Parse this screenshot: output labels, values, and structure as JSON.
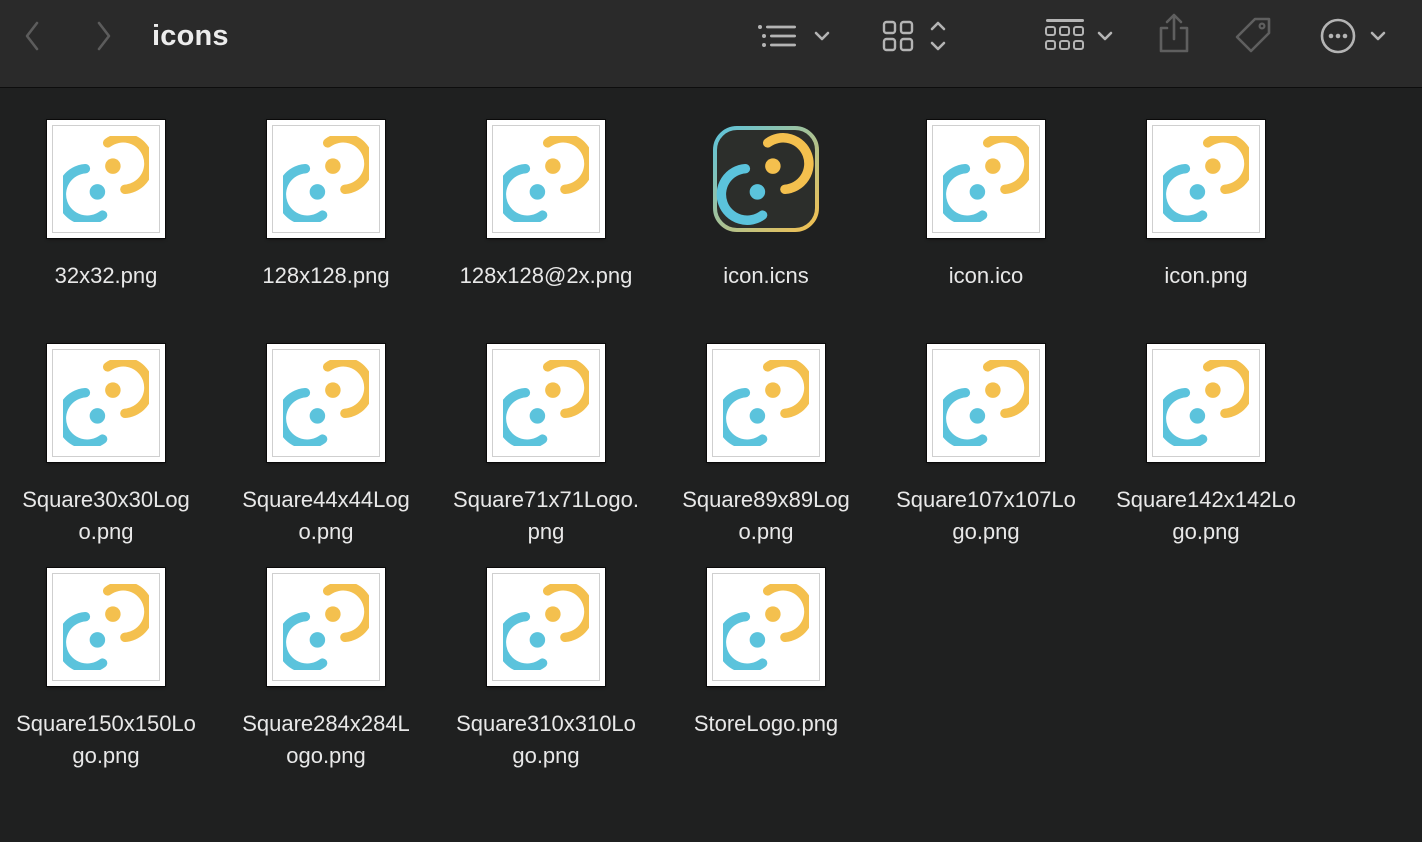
{
  "window": {
    "title": "icons"
  },
  "toolbar": {
    "back_icon": "chevron-left-icon",
    "forward_icon": "chevron-right-icon",
    "list_view_icon": "list-view-icon",
    "grid_view_icon": "icon-grid-icon",
    "group_icon": "group-grid-icon",
    "share_icon": "share-icon",
    "tag_icon": "tag-icon",
    "more_icon": "ellipsis-circle-icon"
  },
  "colors": {
    "logo_yellow": "#f4c04e",
    "logo_blue": "#5bc3dc",
    "background": "#1f2020",
    "toolbar": "#2a2a2a"
  },
  "files": [
    {
      "name": "32x32.png",
      "line1": "32x32.png",
      "line2": ""
    },
    {
      "name": "128x128.png",
      "line1": "128x128.png",
      "line2": ""
    },
    {
      "name": "128x128@2x.png",
      "line1": "128x128@2x.png",
      "line2": ""
    },
    {
      "name": "icon.icns",
      "line1": "icon.icns",
      "line2": ""
    },
    {
      "name": "icon.ico",
      "line1": "icon.ico",
      "line2": ""
    },
    {
      "name": "icon.png",
      "line1": "icon.png",
      "line2": ""
    },
    {
      "name": "Square30x30Logo.png",
      "line1": "Square30x30Log",
      "line2": "o.png"
    },
    {
      "name": "Square44x44Logo.png",
      "line1": "Square44x44Log",
      "line2": "o.png"
    },
    {
      "name": "Square71x71Logo.png",
      "line1": "Square71x71Logo.",
      "line2": "png"
    },
    {
      "name": "Square89x89Logo.png",
      "line1": "Square89x89Log",
      "line2": "o.png"
    },
    {
      "name": "Square107x107Logo.png",
      "line1": "Square107x107Lo",
      "line2": "go.png"
    },
    {
      "name": "Square142x142Logo.png",
      "line1": "Square142x142Lo",
      "line2": "go.png"
    },
    {
      "name": "Square150x150Logo.png",
      "line1": "Square150x150Lo",
      "line2": "go.png"
    },
    {
      "name": "Square284x284Logo.png",
      "line1": "Square284x284L",
      "line2": "ogo.png"
    },
    {
      "name": "Square310x310Logo.png",
      "line1": "Square310x310Lo",
      "line2": "go.png"
    },
    {
      "name": "StoreLogo.png",
      "line1": "StoreLogo.png",
      "line2": ""
    }
  ]
}
